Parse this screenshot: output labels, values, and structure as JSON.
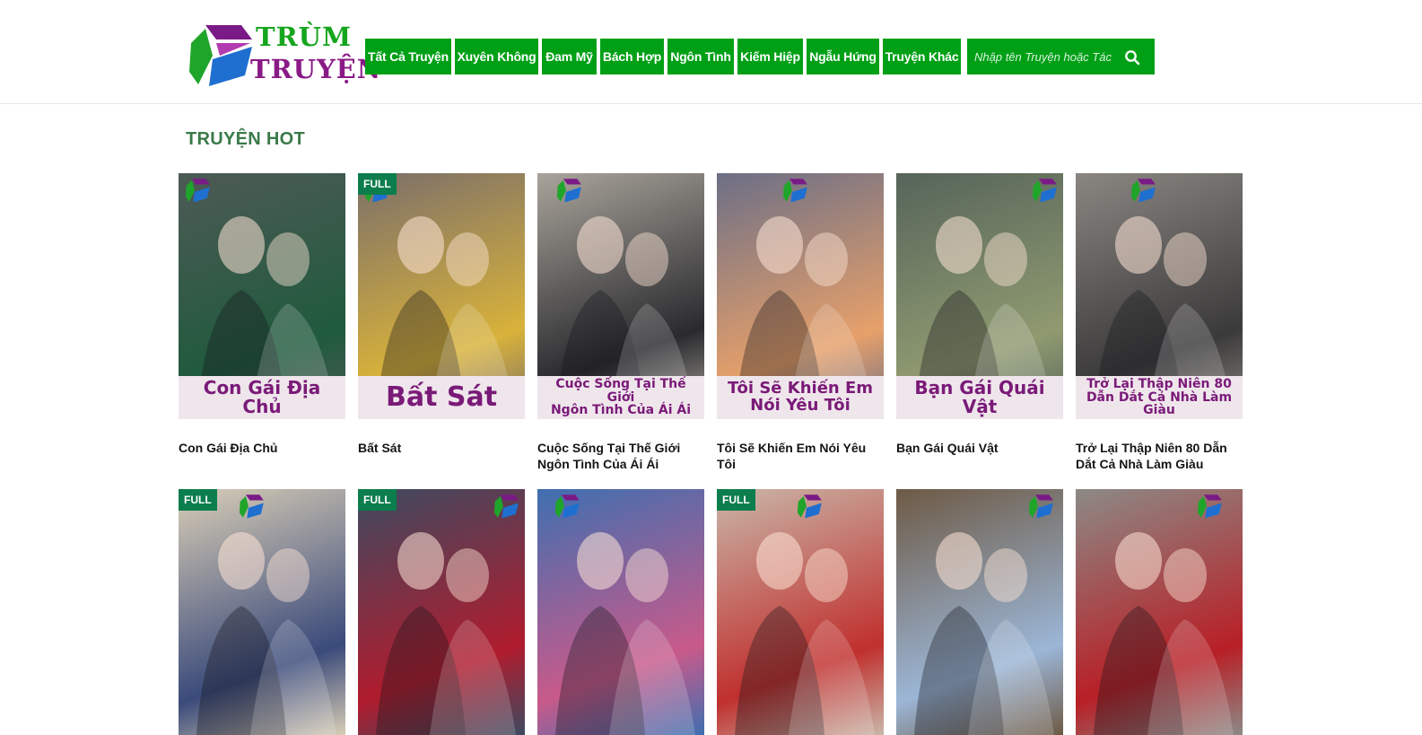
{
  "site": {
    "logo_line1": "TRÙM",
    "logo_line2": "TRUYỆN"
  },
  "nav": {
    "items": [
      {
        "label": "Tất Cả Truyện"
      },
      {
        "label": "Xuyên Không"
      },
      {
        "label": "Đam Mỹ"
      },
      {
        "label": "Bách Hợp"
      },
      {
        "label": "Ngôn Tình"
      },
      {
        "label": "Kiếm Hiệp"
      },
      {
        "label": "Ngẫu Hứng"
      },
      {
        "label": "Truyện Khác"
      }
    ],
    "search_placeholder": "Nhập tên Truyện hoặc Tác"
  },
  "main": {
    "section_title": "TRUYỆN HOT",
    "badge_label": "FULL",
    "stories": [
      {
        "title": "Con Gái Địa Chủ",
        "cover_lines": [
          "Con Gái Địa Chủ"
        ],
        "full": false,
        "bg": "#4e5a55",
        "accent": "#1f5a3d"
      },
      {
        "title": "Bất Sát",
        "cover_lines": [
          "Bất Sát"
        ],
        "full": true,
        "bg": "#7b6f6a",
        "accent": "#d8b23a"
      },
      {
        "title": "Cuộc Sống Tại Thế Giới Ngôn Tình Của Ái Ái",
        "cover_lines": [
          "Cuộc Sống Tại Thế Giới",
          "Ngôn Tình Của Ái Ái"
        ],
        "full": false,
        "bg": "#a9a49b",
        "accent": "#2a2a2e"
      },
      {
        "title": "Tôi Sẽ Khiến Em Nói Yêu Tôi",
        "cover_lines": [
          "Tôi Sẽ Khiến Em",
          "Nói Yêu Tôi"
        ],
        "full": false,
        "bg": "#6c6f86",
        "accent": "#e6a06a"
      },
      {
        "title": "Bạn Gái Quái Vật",
        "cover_lines": [
          "Bạn Gái Quái Vật"
        ],
        "full": false,
        "bg": "#56645a",
        "accent": "#8f9a70"
      },
      {
        "title": "Trở Lại Thập Niên 80 Dẫn Dắt Cả Nhà Làm Giàu",
        "cover_lines": [
          "Trở Lại Thập Niên 80",
          "Dẫn Dắt Cả Nhà Làm Giàu"
        ],
        "full": false,
        "bg": "#8a8682",
        "accent": "#3b3a3a"
      },
      {
        "title": "",
        "cover_lines": [],
        "full": true,
        "bg": "#d8cdb6",
        "accent": "#3a4a7a"
      },
      {
        "title": "",
        "cover_lines": [],
        "full": true,
        "bg": "#3d4a60",
        "accent": "#b01c2e"
      },
      {
        "title": "",
        "cover_lines": [],
        "full": false,
        "bg": "#3f6fb0",
        "accent": "#c85a8a"
      },
      {
        "title": "",
        "cover_lines": [],
        "full": true,
        "bg": "#c9b6a8",
        "accent": "#c0302e"
      },
      {
        "title": "",
        "cover_lines": [],
        "full": false,
        "bg": "#6e5a45",
        "accent": "#9bb6d6"
      },
      {
        "title": "",
        "cover_lines": [],
        "full": false,
        "bg": "#8c8a86",
        "accent": "#b81f26"
      }
    ]
  },
  "icons": {
    "search": "search-icon",
    "logo": "logo-cube-icon"
  },
  "colors": {
    "nav_bg": "#00a016",
    "section_title": "#3a7a4a",
    "badge": "#0c7d4d",
    "cover_title": "#7a1a78"
  }
}
